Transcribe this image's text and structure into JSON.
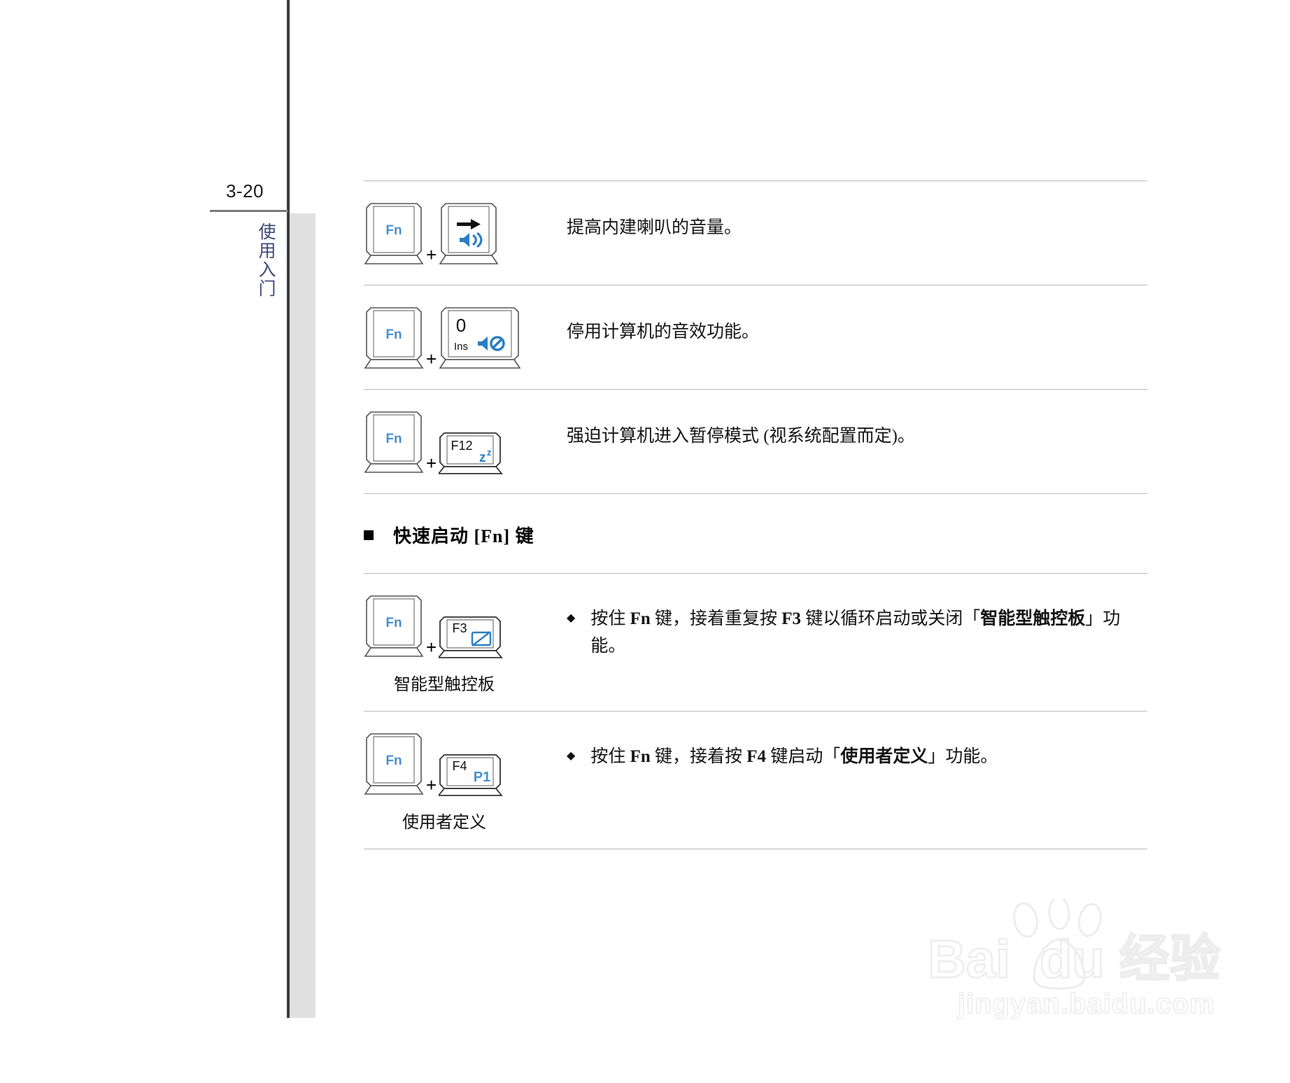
{
  "page": {
    "number": "3-20",
    "chapter_label": "使用入门"
  },
  "shortcut_table_1": {
    "rows": [
      {
        "key1": "Fn",
        "key2_main": "",
        "key2_sub": "",
        "key2_icon": "volume-up-icon",
        "key2_glyph": "arrow-right",
        "description": "提高内建喇叭的音量。"
      },
      {
        "key1": "Fn",
        "key2_main": "0",
        "key2_sub": "Ins",
        "key2_icon": "volume-mute-icon",
        "key2_glyph": "",
        "description": "停用计算机的音效功能。"
      },
      {
        "key1": "Fn",
        "key2_main": "F12",
        "key2_sub": "",
        "key2_icon": "sleep-zz-icon",
        "key2_glyph": "z",
        "description": "强迫计算机进入暂停模式 (视系统配置而定)。"
      }
    ]
  },
  "section": {
    "heading": "快速启动 [Fn] 键"
  },
  "shortcut_table_2": {
    "rows": [
      {
        "key1": "Fn",
        "key2_main": "F3",
        "key2_icon": "touchpad-toggle-icon",
        "caption": "智能型触控板",
        "bullet": "◆",
        "desc_parts": [
          {
            "t": "按住 ",
            "b": false
          },
          {
            "t": "Fn",
            "b": true
          },
          {
            "t": " 键，接着重复按 ",
            "b": false
          },
          {
            "t": "F3",
            "b": true
          },
          {
            "t": " 键以循环启动或关闭「",
            "b": false
          },
          {
            "t": "智能型触控板",
            "b": true
          },
          {
            "t": "」功能。",
            "b": false
          }
        ]
      },
      {
        "key1": "Fn",
        "key2_main": "F4",
        "key2_icon": "p1-key-icon",
        "key2_side": "P1",
        "caption": "使用者定义",
        "bullet": "◆",
        "desc_parts": [
          {
            "t": "按住 ",
            "b": false
          },
          {
            "t": "Fn",
            "b": true
          },
          {
            "t": " 键，接着按 ",
            "b": false
          },
          {
            "t": "F4",
            "b": true
          },
          {
            "t": " 键启动「",
            "b": false
          },
          {
            "t": "使用者定义",
            "b": true
          },
          {
            "t": "」功能。",
            "b": false
          }
        ]
      }
    ]
  },
  "watermark": {
    "brand": "Bai du 经验",
    "url": "jingyan.baidu.com"
  },
  "colors": {
    "key_letter_blue": "#4a8fd0",
    "chapter_blue": "#3d4a77",
    "rule_gray": "#b9b9b9",
    "band_gray": "#e0e0e0",
    "vrule_dark": "#3a3a3a"
  }
}
